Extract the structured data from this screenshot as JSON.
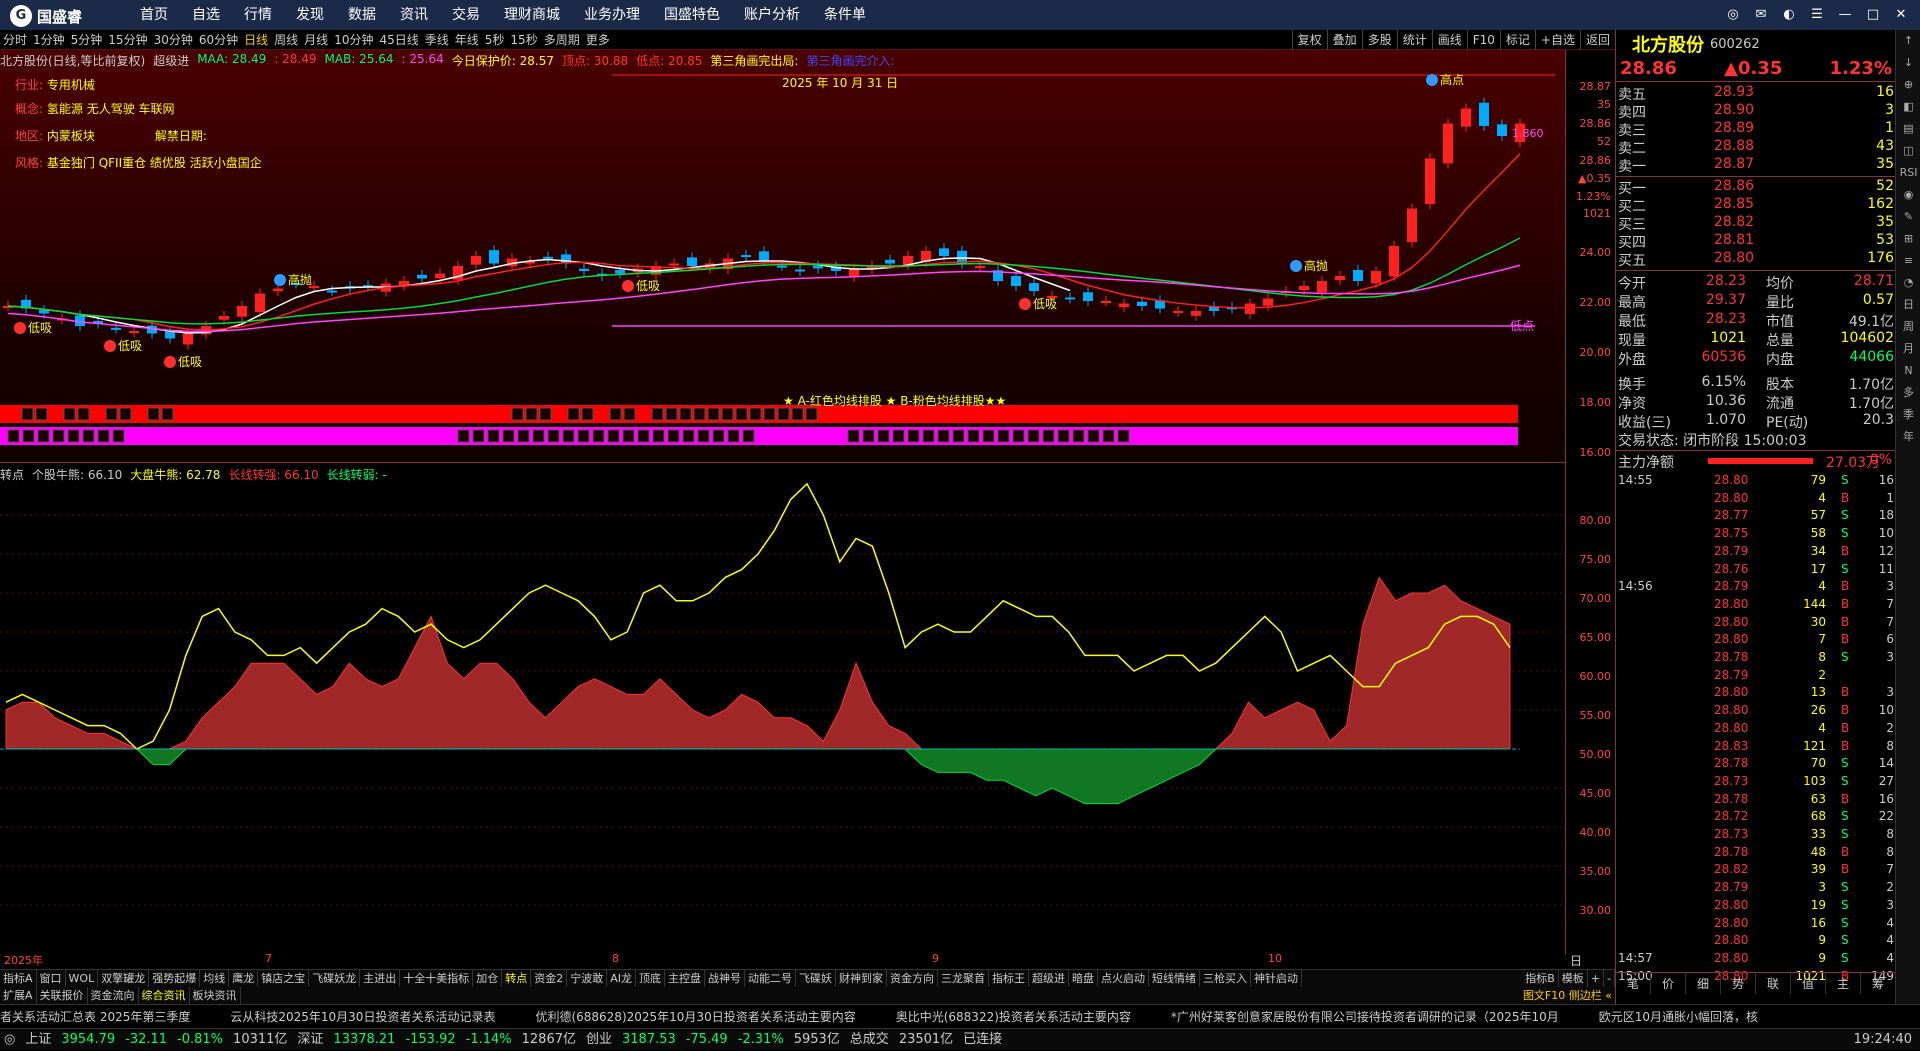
{
  "app": {
    "logo_text": "国盛睿",
    "logo_icon": "G"
  },
  "menu": [
    "首页",
    "自选",
    "行情",
    "发现",
    "数据",
    "资讯",
    "交易",
    "理财商城",
    "业务办理",
    "国盛特色",
    "账户分析",
    "条件单"
  ],
  "periods": [
    "分时",
    "1分钟",
    "5分钟",
    "15分钟",
    "30分钟",
    "60分钟",
    "日线",
    "周线",
    "月线",
    "10分钟",
    "45日线",
    "季线",
    "年线",
    "5秒",
    "15秒",
    "多周期",
    "更多"
  ],
  "active_period": "日线",
  "chart_tools": [
    "复权",
    "叠加",
    "多股",
    "统计",
    "画线",
    "F10",
    "标记",
    "+自选",
    "返回"
  ],
  "info": {
    "title": "北方股份(日线,等比前复权)",
    "signal": "超级进",
    "maa_label": "MAA: 28.49",
    "maa2": ": 28.49",
    "mab_label": "MAB: 25.64",
    "mab2": ": 25.64",
    "protect": "今日保护价: 28.57",
    "top": "顶点: 30.88",
    "low": "低点: 20.85",
    "tri1": "第三角画完出局:",
    "tri2": "第三角画完介入:"
  },
  "tags": [
    {
      "k": "行业:",
      "v": "专用机械"
    },
    {
      "k": "概念:",
      "v": "氢能源 无人驾驶 车联网"
    },
    {
      "k": "地区:",
      "v": "内蒙板块",
      "k2": "解禁日期:"
    },
    {
      "k": "风格:",
      "v": "基金独门 QFII重仓 绩优股 活跃小盘国企"
    }
  ],
  "date_label": "2025 年 10 月 31 日",
  "annotations": {
    "high": "高抛",
    "low": "低吸",
    "lowdian": "低点",
    "gaodian": "高点",
    "price_1860": "1.860"
  },
  "strip_title": "★ A-红色均线排股 ★ B-粉色均线排股★★",
  "price_axis_upper": [
    "28.87",
    "35",
    "28.86",
    "52",
    "28.86",
    "▲0.35",
    "1.23%",
    "1021",
    "24.00",
    "22.00",
    "20.00",
    "18.00",
    "16.00"
  ],
  "sub_indicator": {
    "name": "转点",
    "a": "个股牛熊: 66.10",
    "b": "大盘牛熊: 62.78",
    "c": "长线转强: 66.10",
    "d": "长线转弱: -"
  },
  "price_axis_lower": [
    "80.00",
    "75.00",
    "70.00",
    "65.00",
    "60.00",
    "55.00",
    "50.00",
    "45.00",
    "40.00",
    "35.00",
    "30.00"
  ],
  "x_axis": [
    "2025年",
    "7",
    "8",
    "9",
    "10"
  ],
  "x_right": "日线",
  "tabs1": [
    "指标A",
    "窗口",
    "WOL",
    "双擎罐龙",
    "强势起爆",
    "均线",
    "鹰龙",
    "镇店之宝",
    "飞碟妖龙",
    "主进出",
    "十全十美指标",
    "加仓",
    "转点",
    "资金2",
    "宁波敢",
    "AI龙",
    "顶底",
    "主控盘",
    "战神号",
    "动能二号",
    "飞碟妖",
    "财神到家",
    "资金方向",
    "三龙聚首",
    "指标王",
    "超级进",
    "暗盘",
    "点火启动",
    "短线情绪",
    "三枪买入",
    "神针启动"
  ],
  "tabs1_active": "转点",
  "tabs1_right": [
    "指标B",
    "模板",
    "+",
    "-"
  ],
  "tabs2": [
    "扩展A",
    "关联报价",
    "资金流向",
    "综合资讯",
    "板块资讯"
  ],
  "tabs2_active": "综合资讯",
  "tabs2_right": "图文F10 侧边栏 «",
  "news": [
    "者关系活动汇总表 2025年第三季度",
    "云从科技2025年10月30日投资者关系活动记录表",
    "优利德(688628)2025年10月30日投资者关系活动主要内容",
    "奥比中光(688322)投资者关系活动主要内容",
    "*广州好莱客创意家居股份有限公司接待投资者调研的记录（2025年10月",
    "欧元区10月通胀小幅回落，核"
  ],
  "status": {
    "sh": "上证",
    "sh_v": "3954.79",
    "sh_c": "-32.11",
    "sh_p": "-0.81%",
    "sh_a": "10311亿",
    "sz": "深证",
    "sz_v": "13378.21",
    "sz_c": "-153.92",
    "sz_p": "-1.14%",
    "sz_a": "12867亿",
    "cy": "创业",
    "cy_v": "3187.53",
    "cy_c": "-75.49",
    "cy_p": "-2.31%",
    "cy_a": "5953亿",
    "total": "总成交",
    "total_v": "23501亿",
    "conn": "已连接",
    "time": "19:24:40"
  },
  "stock": {
    "name": "北方股份",
    "code": "600262",
    "price": "28.86",
    "change": "▲0.35",
    "pct": "1.23%"
  },
  "asks": [
    {
      "l": "卖五",
      "p": "28.93",
      "v": "16"
    },
    {
      "l": "卖四",
      "p": "28.90",
      "v": "3"
    },
    {
      "l": "卖三",
      "p": "28.89",
      "v": "1"
    },
    {
      "l": "卖二",
      "p": "28.88",
      "v": "43"
    },
    {
      "l": "卖一",
      "p": "28.87",
      "v": "35"
    }
  ],
  "bids": [
    {
      "l": "买一",
      "p": "28.86",
      "v": "52"
    },
    {
      "l": "买二",
      "p": "28.85",
      "v": "162"
    },
    {
      "l": "买三",
      "p": "28.82",
      "v": "35"
    },
    {
      "l": "买四",
      "p": "28.81",
      "v": "53"
    },
    {
      "l": "买五",
      "p": "28.80",
      "v": "176"
    }
  ],
  "quotes": [
    [
      "今开",
      "28.23",
      "均价",
      "28.71"
    ],
    [
      "最高",
      "29.37",
      "量比",
      "0.57"
    ],
    [
      "最低",
      "28.23",
      "市值",
      "49.1亿"
    ],
    [
      "现量",
      "1021",
      "总量",
      "104602"
    ],
    [
      "外盘",
      "60536",
      "内盘",
      "44066"
    ],
    [
      "换手",
      "6.15%",
      "股本",
      "1.70亿"
    ],
    [
      "净资",
      "10.36",
      "流通",
      "1.70亿"
    ],
    [
      "收益(三)",
      "1.070",
      "PE(动)",
      "20.3"
    ]
  ],
  "trade_state": "交易状态: 闭市阶段 15:00:03",
  "zhuli": {
    "label": "主力净额",
    "value": "27.03万",
    "pct": "0%"
  },
  "ticks": [
    [
      "14:55",
      "28.80",
      "79",
      "S",
      "16"
    ],
    [
      "",
      "28.80",
      "4",
      "B",
      "1"
    ],
    [
      "",
      "28.77",
      "57",
      "S",
      "18"
    ],
    [
      "",
      "28.75",
      "58",
      "S",
      "10"
    ],
    [
      "",
      "28.79",
      "34",
      "B",
      "12"
    ],
    [
      "",
      "28.76",
      "17",
      "S",
      "11"
    ],
    [
      "14:56",
      "28.79",
      "4",
      "B",
      "3"
    ],
    [
      "",
      "28.80",
      "144",
      "B",
      "7"
    ],
    [
      "",
      "28.80",
      "30",
      "B",
      "7"
    ],
    [
      "",
      "28.80",
      "7",
      "B",
      "6"
    ],
    [
      "",
      "28.78",
      "8",
      "S",
      "3"
    ],
    [
      "",
      "28.79",
      "2",
      "",
      ""
    ],
    [
      "",
      "28.80",
      "13",
      "B",
      "3"
    ],
    [
      "",
      "28.80",
      "26",
      "B",
      "10"
    ],
    [
      "",
      "28.80",
      "4",
      "B",
      "2"
    ],
    [
      "",
      "28.83",
      "121",
      "B",
      "8"
    ],
    [
      "",
      "28.78",
      "70",
      "S",
      "14"
    ],
    [
      "",
      "28.73",
      "103",
      "S",
      "27"
    ],
    [
      "",
      "28.78",
      "63",
      "B",
      "16"
    ],
    [
      "",
      "28.72",
      "68",
      "S",
      "22"
    ],
    [
      "",
      "28.73",
      "33",
      "S",
      "8"
    ],
    [
      "",
      "28.78",
      "48",
      "B",
      "8"
    ],
    [
      "",
      "28.82",
      "39",
      "B",
      "7"
    ],
    [
      "",
      "28.79",
      "3",
      "S",
      "2"
    ],
    [
      "",
      "28.80",
      "19",
      "S",
      "3"
    ],
    [
      "",
      "28.80",
      "16",
      "S",
      "4"
    ],
    [
      "",
      "28.80",
      "9",
      "S",
      "4"
    ],
    [
      "14:57",
      "28.80",
      "9",
      "S",
      "4"
    ],
    [
      "15:00",
      "28.80",
      "1021",
      "B",
      "149"
    ]
  ],
  "right_tabs": [
    "笔",
    "价",
    "细",
    "势",
    "联",
    "值",
    "主",
    "筹"
  ],
  "sidebar": [
    "日",
    "周",
    "月",
    "N",
    "多",
    "季",
    "年"
  ]
}
